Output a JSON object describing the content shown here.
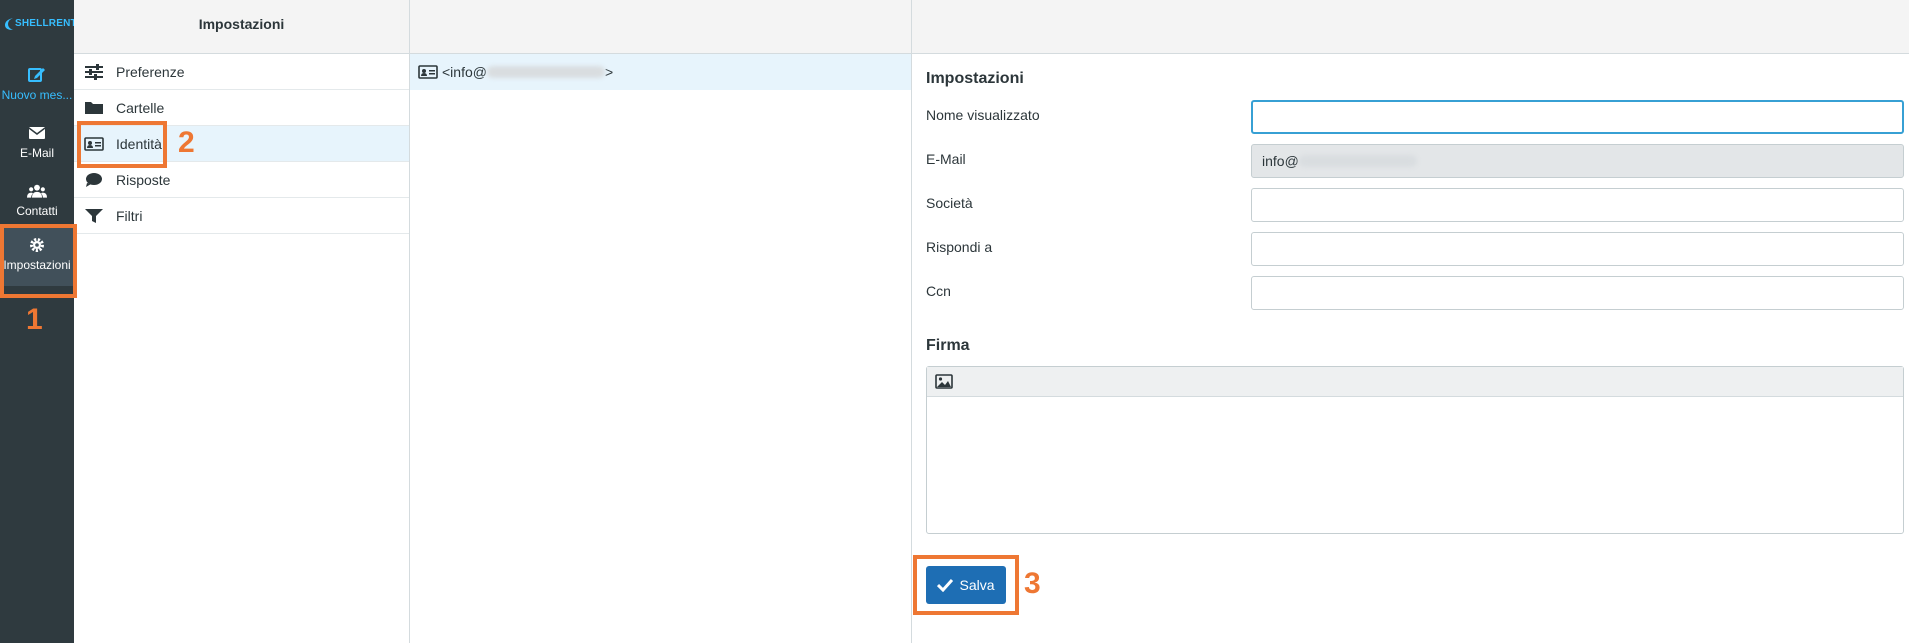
{
  "colors": {
    "nav_bg": "#2f3a3f",
    "accent": "#37beff",
    "primary_button": "#1e6eb4",
    "annotation": "#ee7733",
    "selected_row": "#e7f4fc"
  },
  "app": {
    "logo_text": "SHELLRENT"
  },
  "nav": {
    "compose": {
      "label": "Nuovo mes...",
      "icon": "compose-icon"
    },
    "mail": {
      "label": "E-Mail",
      "icon": "envelope-icon"
    },
    "contacts": {
      "label": "Contatti",
      "icon": "users-icon"
    },
    "settings": {
      "label": "Impostazioni",
      "icon": "gear-icon"
    }
  },
  "settings_panel": {
    "title": "Impostazioni",
    "items": [
      {
        "label": "Preferenze",
        "icon": "sliders-icon"
      },
      {
        "label": "Cartelle",
        "icon": "folder-icon"
      },
      {
        "label": "Identità",
        "icon": "id-card-icon"
      },
      {
        "label": "Risposte",
        "icon": "speech-bubble-icon"
      },
      {
        "label": "Filtri",
        "icon": "filter-icon"
      }
    ]
  },
  "identities": {
    "items": [
      {
        "prefix": "<info@",
        "suffix": ">"
      }
    ]
  },
  "form": {
    "section_title": "Impostazioni",
    "fields": {
      "name": {
        "label": "Nome visualizzato",
        "value": ""
      },
      "email": {
        "label": "E-Mail",
        "value": "info@"
      },
      "organization": {
        "label": "Società",
        "value": ""
      },
      "reply_to": {
        "label": "Rispondi a",
        "value": ""
      },
      "bcc": {
        "label": "Ccn",
        "value": ""
      }
    },
    "signature_title": "Firma",
    "save_label": "Salva"
  },
  "annotations": {
    "step1": "1",
    "step2": "2",
    "step3": "3"
  }
}
